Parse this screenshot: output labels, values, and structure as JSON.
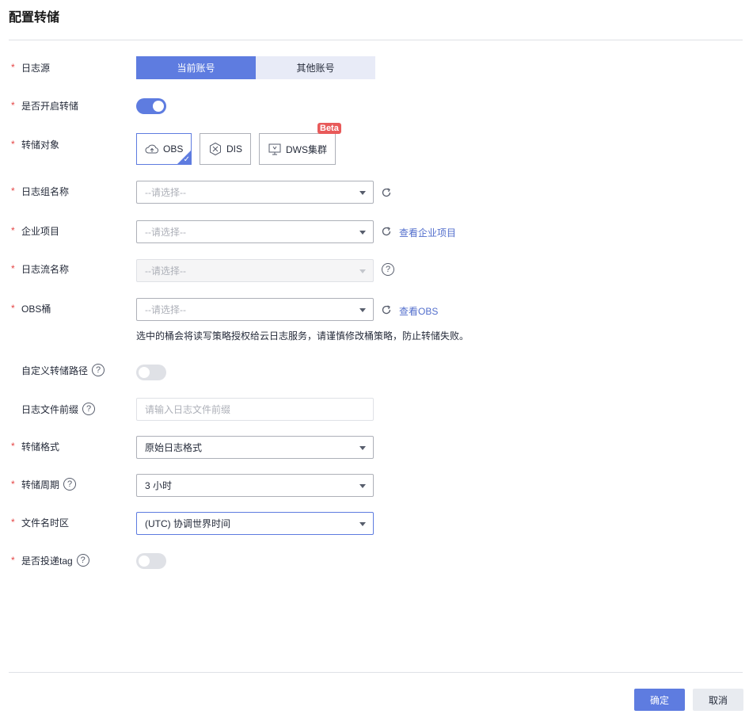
{
  "dialog": {
    "title": "配置转储"
  },
  "fields": {
    "log_source": {
      "label": "日志源",
      "options": [
        "当前账号",
        "其他账号"
      ]
    },
    "enable_transfer": {
      "label": "是否开启转储",
      "enabled": true
    },
    "transfer_target": {
      "label": "转储对象",
      "options": [
        "OBS",
        "DIS",
        "DWS集群"
      ],
      "selected": "OBS",
      "badge": "Beta"
    },
    "log_group": {
      "label": "日志组名称",
      "placeholder": "--请选择--"
    },
    "enterprise_project": {
      "label": "企业项目",
      "placeholder": "--请选择--",
      "link": "查看企业项目"
    },
    "log_stream": {
      "label": "日志流名称",
      "placeholder": "--请选择--"
    },
    "obs_bucket": {
      "label": "OBS桶",
      "placeholder": "--请选择--",
      "link": "查看OBS",
      "hint": "选中的桶会将读写策略授权给云日志服务，请谨慎修改桶策略，防止转储失败。"
    },
    "custom_path": {
      "label": "自定义转储路径",
      "enabled": false
    },
    "file_prefix": {
      "label": "日志文件前缀",
      "placeholder": "请输入日志文件前缀"
    },
    "format": {
      "label": "转储格式",
      "value": "原始日志格式"
    },
    "period": {
      "label": "转储周期",
      "value": "3 小时"
    },
    "timezone": {
      "label": "文件名时区",
      "value": "(UTC) 协调世界时间"
    },
    "deliver_tag": {
      "label": "是否投递tag",
      "enabled": false
    }
  },
  "footer": {
    "confirm": "确定",
    "cancel": "取消"
  },
  "colors": {
    "primary": "#5e7ce0",
    "required": "#e54545",
    "link": "#526ecc",
    "badge": "#e85a5a"
  }
}
